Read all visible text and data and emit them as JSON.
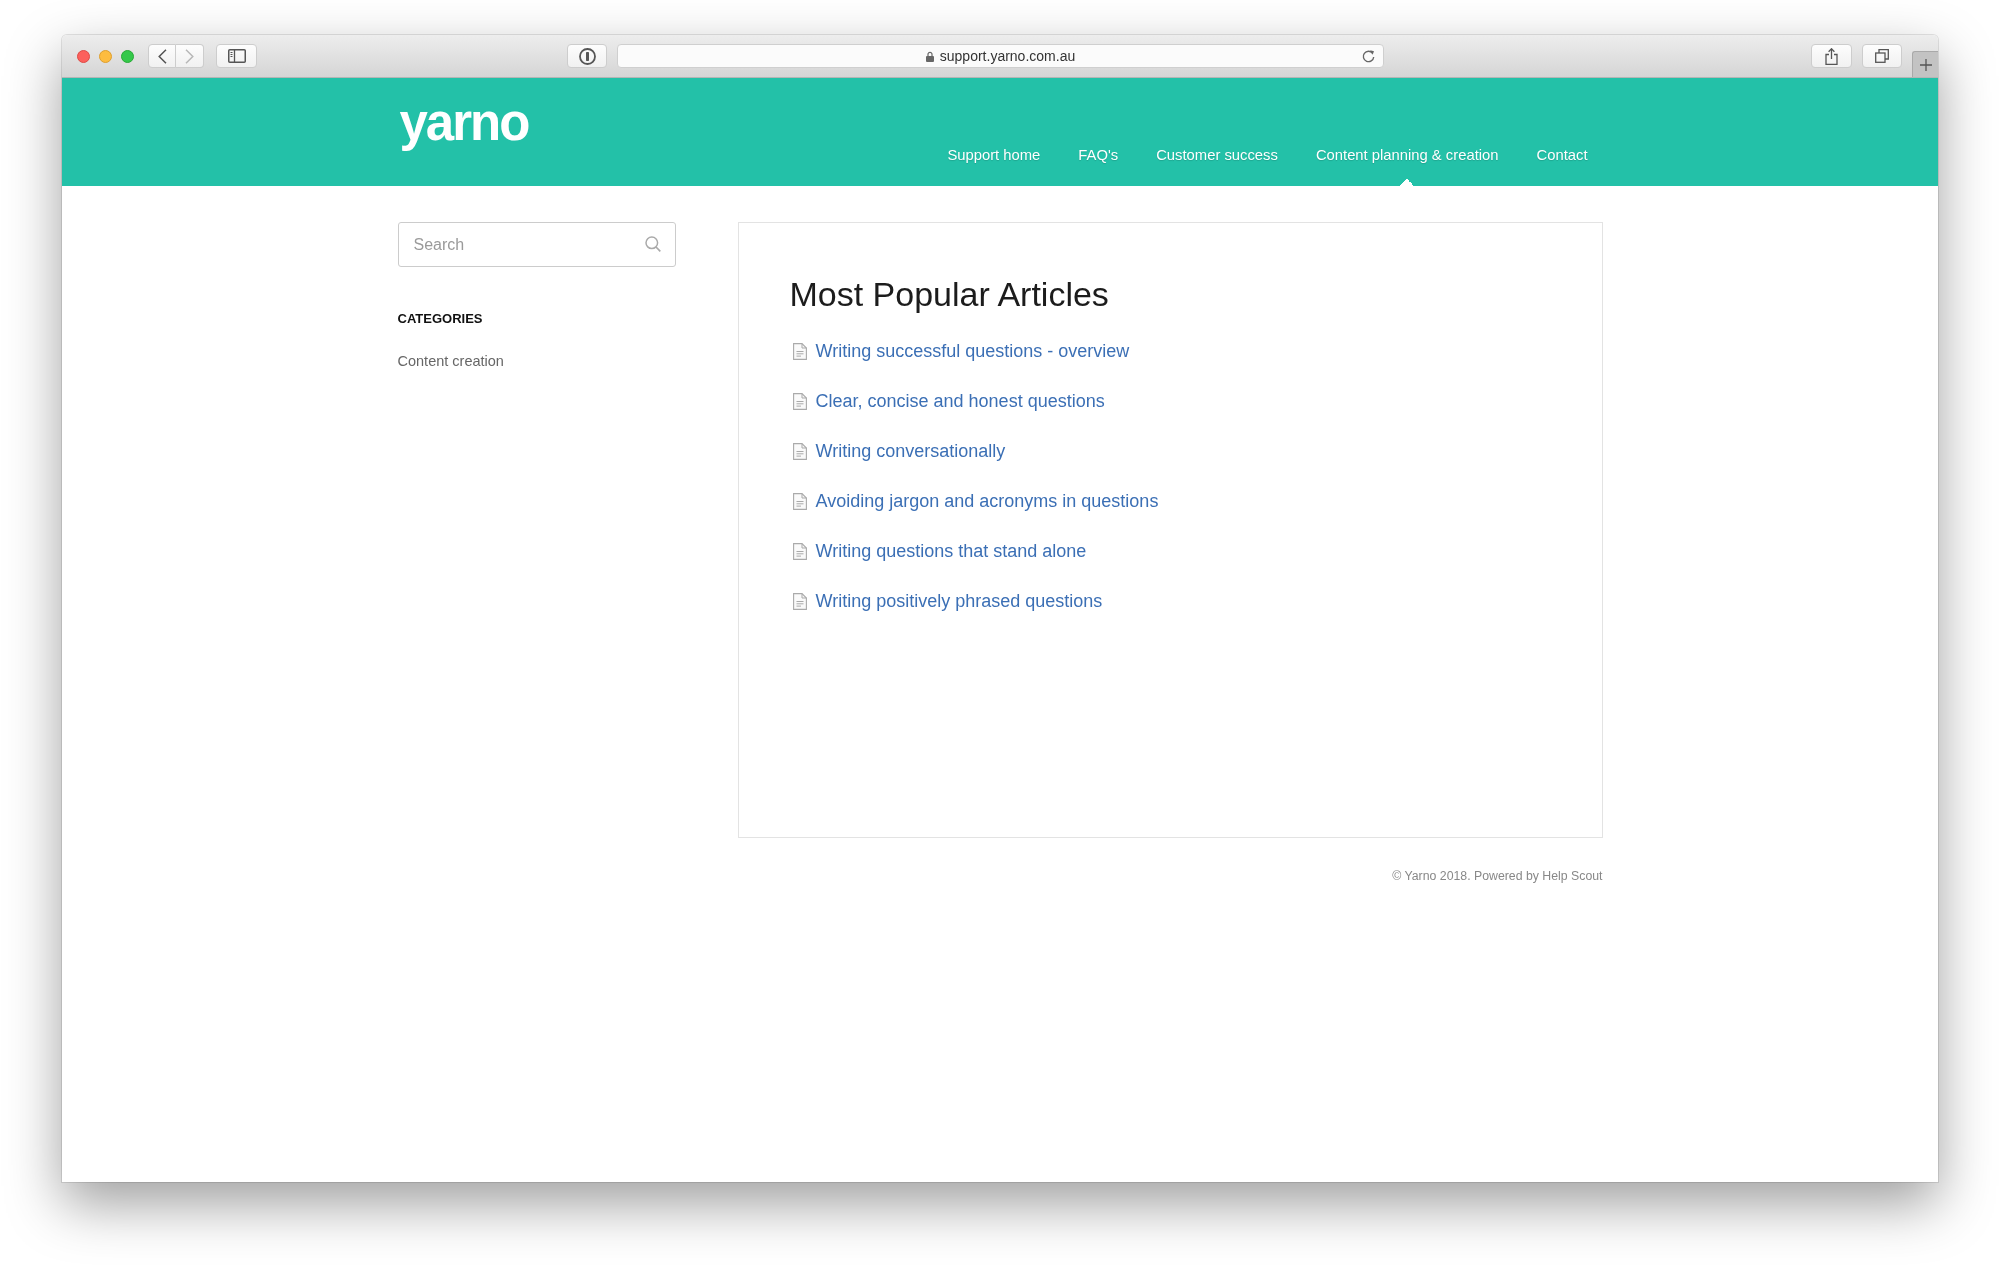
{
  "browser": {
    "url": "support.yarno.com.au",
    "back_disabled": false,
    "forward_disabled": true
  },
  "header": {
    "logo": "yarno",
    "nav": [
      {
        "label": "Support home",
        "selected": false
      },
      {
        "label": "FAQ's",
        "selected": false
      },
      {
        "label": "Customer success",
        "selected": false
      },
      {
        "label": "Content planning & creation",
        "selected": true
      },
      {
        "label": "Contact",
        "selected": false
      }
    ]
  },
  "sidebar": {
    "search": {
      "placeholder": "Search"
    },
    "heading": "CATEGORIES",
    "categories": [
      "Content creation"
    ]
  },
  "main": {
    "title": "Most Popular Articles",
    "articles": [
      "Writing successful questions - overview",
      "Clear, concise and honest questions",
      "Writing conversationally",
      "Avoiding jargon and acronyms in questions",
      "Writing questions that stand alone",
      "Writing positively phrased questions"
    ]
  },
  "footer": {
    "text": "© Yarno 2018. Powered by Help Scout"
  }
}
